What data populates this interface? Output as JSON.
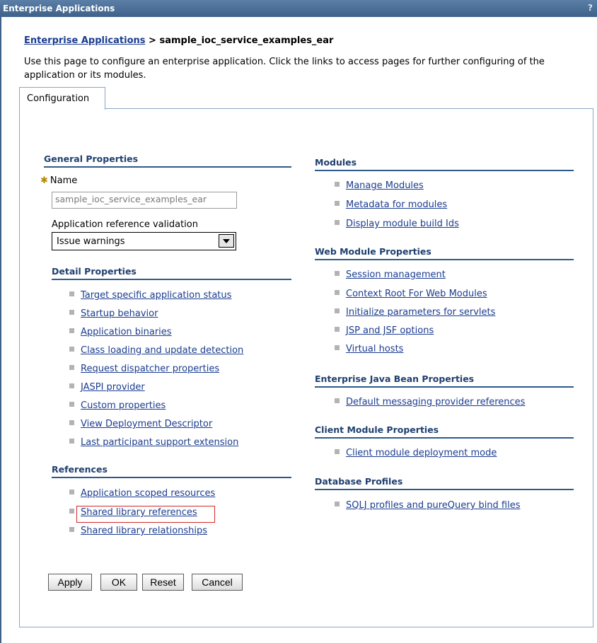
{
  "window": {
    "title": "Enterprise Applications",
    "help": "?"
  },
  "breadcrumb": {
    "link": "Enterprise Applications",
    "separator": " > ",
    "current": "sample_ioc_service_examples_ear"
  },
  "description": "Use this page to configure an enterprise application. Click the links to access pages for further configuring of the application or its modules.",
  "tabs": [
    {
      "label": "Configuration"
    }
  ],
  "general_properties": {
    "heading": "General Properties",
    "name_label": "Name",
    "name_value": "sample_ioc_service_examples_ear",
    "validation_label": "Application reference validation",
    "validation_value": "Issue warnings"
  },
  "detail_properties": {
    "heading": "Detail Properties",
    "items": [
      "Target specific application status",
      "Startup behavior",
      "Application binaries",
      "Class loading and update detection",
      "Request dispatcher properties",
      "JASPI provider",
      "Custom properties",
      "View Deployment Descriptor",
      "Last participant support extension"
    ]
  },
  "references": {
    "heading": "References",
    "items": [
      "Application scoped resources",
      "Shared library references",
      "Shared library relationships"
    ]
  },
  "modules": {
    "heading": "Modules",
    "items": [
      "Manage Modules",
      "Metadata for modules",
      "Display module build Ids"
    ]
  },
  "web_module_properties": {
    "heading": "Web Module Properties",
    "items": [
      "Session management",
      "Context Root For Web Modules",
      "Initialize parameters for servlets",
      "JSP and JSF options",
      "Virtual hosts"
    ]
  },
  "ejb_properties": {
    "heading": "Enterprise Java Bean Properties",
    "items": [
      "Default messaging provider references"
    ]
  },
  "client_module_properties": {
    "heading": "Client Module Properties",
    "items": [
      "Client module deployment mode"
    ]
  },
  "database_profiles": {
    "heading": "Database Profiles",
    "items": [
      "SQLJ profiles and pureQuery bind files"
    ]
  },
  "buttons": {
    "apply": "Apply",
    "ok": "OK",
    "reset": "Reset",
    "cancel": "Cancel"
  },
  "colors": {
    "titlebar": "#3d6189",
    "link": "#1a3c8f",
    "highlight": "#d62828"
  }
}
